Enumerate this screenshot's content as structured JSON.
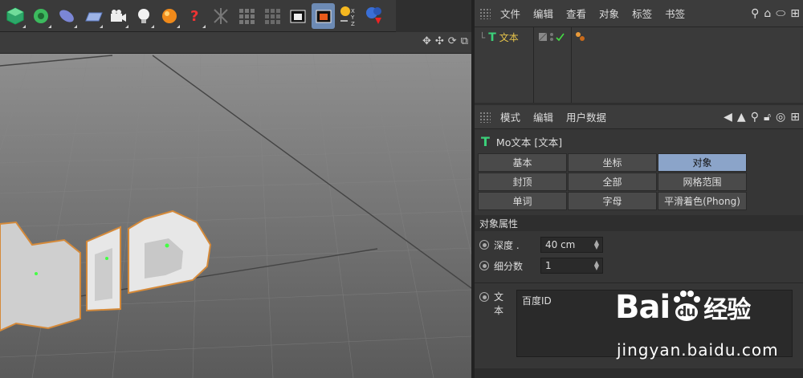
{
  "toolbar": {
    "icons": [
      "cube-icon",
      "gear-gen-icon",
      "deformer-icon",
      "floor-icon",
      "camera-icon",
      "light-icon",
      "material-icon",
      "help-icon",
      "axis-x-icon",
      "axis-grid-icon",
      "axis-grid2-icon",
      "render-view-icon",
      "render-active-icon",
      "coords-icon",
      "render-settings-icon"
    ]
  },
  "object_manager": {
    "menu": [
      "文件",
      "编辑",
      "查看",
      "对象",
      "标签",
      "书签"
    ],
    "object_name": "文本"
  },
  "attribute_manager": {
    "menu": [
      "模式",
      "编辑",
      "用户数据"
    ],
    "title": "Mo文本 [文本]",
    "tabs": [
      "基本",
      "坐标",
      "对象",
      "封顶",
      "全部",
      "网格范围",
      "单词",
      "字母",
      "平滑着色(Phong)"
    ],
    "selected_tab": "对象",
    "section": "对象属性",
    "depth_label": "深度 .",
    "depth_value": "40 cm",
    "subdiv_label": "细分数",
    "subdiv_value": "1",
    "text_label": "文本",
    "text_value": "百度ID"
  },
  "watermark": {
    "logo_a": "Bai",
    "logo_b": "du",
    "logo_c": "经验",
    "url": "jingyan.baidu.com"
  }
}
